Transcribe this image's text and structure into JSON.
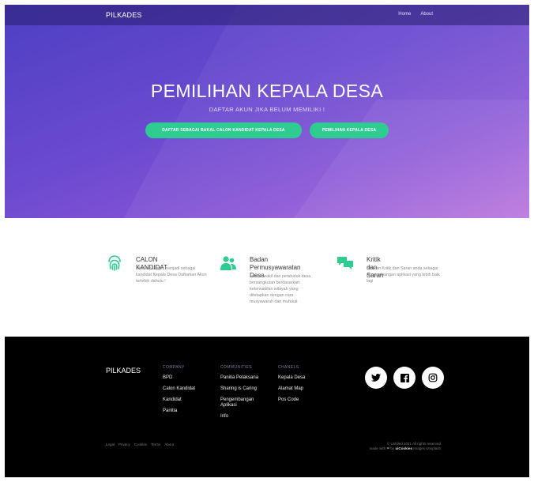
{
  "navbar": {
    "brand": "PILKADES",
    "links": [
      "Home",
      "About"
    ]
  },
  "hero": {
    "title": "PEMILIHAN KEPALA DESA",
    "subtitle": "DAFTAR AKUN JIKA BELUM MEMILIKI !",
    "buttons": [
      "DAFTAR SEBAGAI BAKAL CALON KANDIDAT KEPALA DESA",
      "PEMILIHAN KEPALA DESA"
    ]
  },
  "features": [
    {
      "icon": "fingerprint-icon",
      "title": "CALON KANDIDAT",
      "description": "Jika anda ingin menjadi sebagai kandidat Kepala Desa Daftarkan Akun terlebih dahulu !"
    },
    {
      "icon": "users-icon",
      "title": "Badan Permusyawaratan Desa",
      "description": "adalah wakil dari penduduk desa bersangkutan berdasarkan keterwakilan wilayah yang ditetapkan dengan cara musyawarah dan mufakat"
    },
    {
      "icon": "chat-icon",
      "title": "Kritik dan Saran",
      "description": "Berikan Kritik dan Saran anda sebagai pengembangan aplikasi yang lebih baik lagi"
    }
  ],
  "footer": {
    "brand": "PILKADES",
    "columns": [
      {
        "heading": "COMPANY",
        "links": [
          "BPD",
          "Calon Kandidat",
          "Kandidat",
          "Panitia"
        ]
      },
      {
        "heading": "COMMUNITIES",
        "links": [
          "Panitia Pelaksana",
          "Sharing is Caring",
          "Pengembangan Aplikasi",
          "Info"
        ]
      },
      {
        "heading": "CHANELS",
        "links": [
          "Kepala Desa",
          "Alamat Map",
          "Pos Code"
        ]
      }
    ],
    "socials": [
      "twitter-icon",
      "facebook-icon",
      "instagram-icon"
    ],
    "legal_links": [
      "Legal",
      "Privacy",
      "Cookies",
      "Terms",
      "About"
    ],
    "copyright": "© Untitled 2021 All rights reserved",
    "made_with_prefix": "made with ❤ by",
    "made_with_name": "uiCookies",
    "made_with_suffix": "Images Unsplash"
  },
  "colors": {
    "hero_start": "#4e3fc2",
    "hero_end": "#b56ad8",
    "accent_green": "#2fcc92",
    "footer_bg": "#000000"
  }
}
